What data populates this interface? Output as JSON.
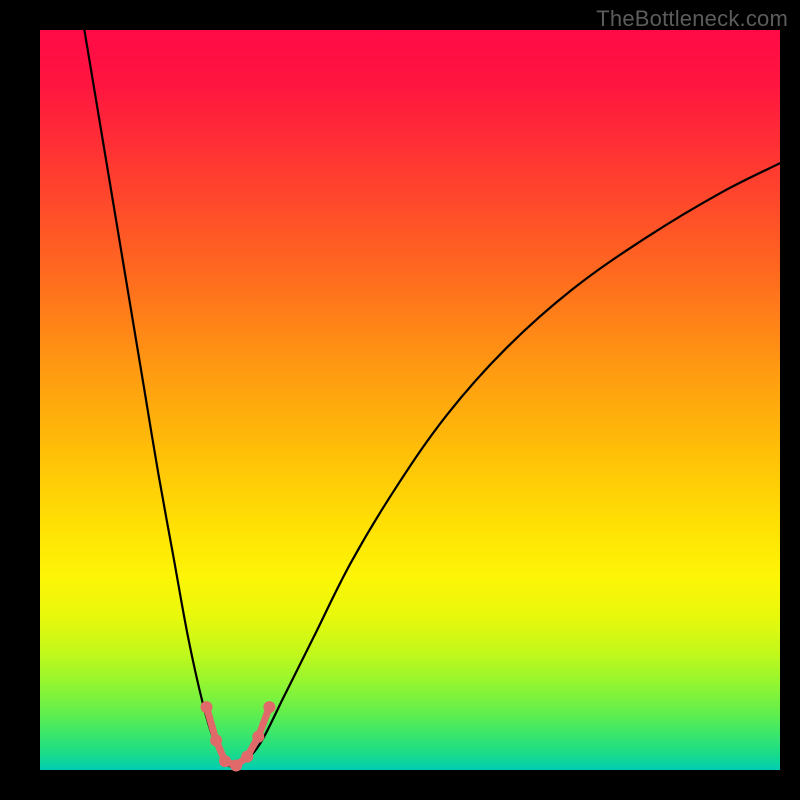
{
  "watermark": "TheBottleneck.com",
  "chart_data": {
    "type": "line",
    "title": "",
    "xlabel": "",
    "ylabel": "",
    "xlim": [
      0,
      100
    ],
    "ylim": [
      0,
      100
    ],
    "series": [
      {
        "name": "bottleneck-curve",
        "x": [
          6,
          8,
          10,
          12,
          14,
          16,
          18,
          20,
          22,
          23.5,
          25,
          26.5,
          28,
          30,
          33,
          37,
          42,
          48,
          55,
          63,
          72,
          82,
          92,
          100
        ],
        "y": [
          100,
          88,
          76,
          64,
          52,
          40,
          29,
          18,
          9,
          4,
          1,
          0.5,
          1.5,
          4,
          10,
          18,
          28,
          38,
          48,
          57,
          65,
          72,
          78,
          82
        ]
      }
    ],
    "markers": {
      "name": "trough-highlight",
      "color": "#e06a6a",
      "points": [
        {
          "x": 22.5,
          "y": 8.5
        },
        {
          "x": 23.8,
          "y": 4.0
        },
        {
          "x": 25.0,
          "y": 1.2
        },
        {
          "x": 26.5,
          "y": 0.6
        },
        {
          "x": 28.0,
          "y": 1.8
        },
        {
          "x": 29.5,
          "y": 4.5
        },
        {
          "x": 31.0,
          "y": 8.5
        }
      ]
    },
    "background_gradient": {
      "top": "#ff0a46",
      "mid": "#ffe104",
      "bottom": "#02ccb3"
    }
  }
}
